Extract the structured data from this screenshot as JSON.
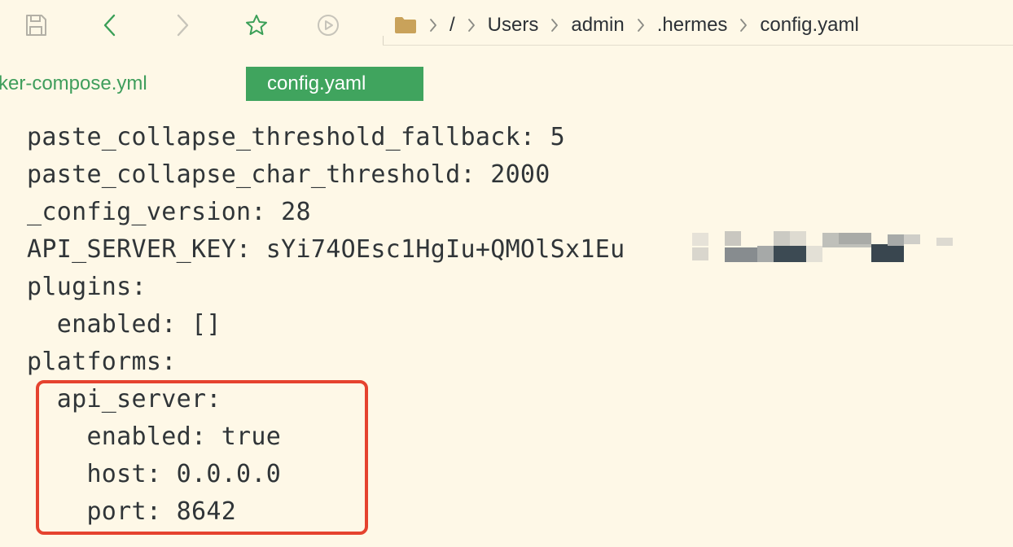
{
  "toolbar": {
    "buttons": [
      {
        "name": "save-button",
        "icon": "save-icon"
      },
      {
        "name": "back-button",
        "icon": "chevron-left-icon"
      },
      {
        "name": "forward-button",
        "icon": "chevron-right-icon"
      },
      {
        "name": "favorite-button",
        "icon": "star-icon"
      },
      {
        "name": "run-button",
        "icon": "play-circle-icon"
      }
    ]
  },
  "breadcrumb": {
    "folder_icon": "folder-icon",
    "segments": [
      "/",
      "Users",
      "admin",
      ".hermes",
      "config.yaml"
    ]
  },
  "tabs": [
    {
      "label": "cker-compose.yml",
      "active": false
    },
    {
      "label": "config.yaml",
      "active": true
    }
  ],
  "editor": {
    "lines": [
      "paste_collapse_threshold_fallback: 5",
      "paste_collapse_char_threshold: 2000",
      "_config_version: 28",
      "API_SERVER_KEY: sYi74OEsc1HgIu+QMOlSx1Eu",
      "plugins:",
      "  enabled: []",
      "platforms:",
      "  api_server:",
      "    enabled: true",
      "    host: 0.0.0.0",
      "    port: 8642"
    ]
  },
  "colors": {
    "background": "#fef8e7",
    "accent_green": "#40a45e",
    "highlight_red": "#e5432f",
    "text": "#303538"
  }
}
